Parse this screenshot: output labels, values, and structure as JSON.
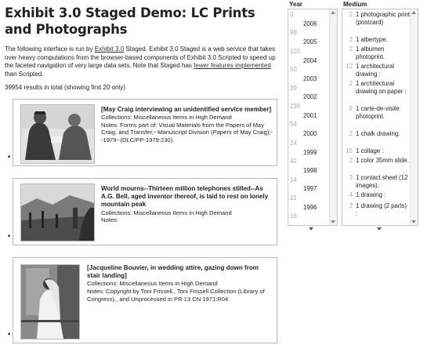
{
  "page": {
    "title": "Exhibit 3.0 Staged Demo: LC Prints and Photographs",
    "intro_text_1": "The following interface is run by ",
    "intro_link_1": "Exhibit 3.0",
    "intro_text_2": " Staged. Exhibit 3.0 Staged is a web service that takes over heavy computations from the browser-based components of Exhibit 3.0 Scripted to speed up the faceted navigation of very large data sets. Note that Staged has ",
    "intro_link_2": "fewer features implemented",
    "intro_text_3": " than Scripted.",
    "results_count": "39954 results in total (showing first 20 only)"
  },
  "results": [
    {
      "title": "[May Craig interviewing an unidentified service member]",
      "lines": [
        "Collections: Miscellaneous Items in High Demand",
        "Notes: Forms part of: Visual Materials from the Papers of May Craig. and Transfer;--Manuscript Division (Papers of May Craig);--1979--(DLC/PP-1979:230)."
      ]
    },
    {
      "title": "World mourns--Thirteen million telephones stilled--As A.G. Bell, aged inventor thereof, is laid to rest on lonely mountain peak",
      "lines": [
        "Collections: Miscellaneous Items in High Demand",
        "Notes:"
      ]
    },
    {
      "title": "[Jacqueline Bouvier, in wedding attire, gazing down from stair landing]",
      "lines": [
        "Collections: Miscellaneous Items in High Demand",
        "Notes: Copyright by Toni Frissell., Toni Frissell Collection (Library of Congress)., and Unprocessed in PR 13 CN 1971:R04"
      ]
    }
  ],
  "facets": {
    "year": {
      "label": "Year",
      "items": [
        {
          "count": "3",
          "value": ""
        },
        {
          "count": "",
          "value": "2006"
        },
        {
          "count": "98",
          "value": ""
        },
        {
          "count": "",
          "value": "2005"
        },
        {
          "count": "103",
          "value": ""
        },
        {
          "count": "",
          "value": "2004"
        },
        {
          "count": "50",
          "value": ""
        },
        {
          "count": "",
          "value": "2003"
        },
        {
          "count": "39",
          "value": ""
        },
        {
          "count": "",
          "value": "2002"
        },
        {
          "count": "239",
          "value": ""
        },
        {
          "count": "",
          "value": "2001"
        },
        {
          "count": "54",
          "value": ""
        },
        {
          "count": "",
          "value": "2000"
        },
        {
          "count": "24",
          "value": ""
        },
        {
          "count": "",
          "value": "1999"
        },
        {
          "count": "42",
          "value": ""
        },
        {
          "count": "",
          "value": "1998"
        },
        {
          "count": "14",
          "value": ""
        },
        {
          "count": "",
          "value": "1997"
        },
        {
          "count": "21",
          "value": ""
        },
        {
          "count": "",
          "value": "1996"
        },
        {
          "count": "16",
          "value": ""
        }
      ]
    },
    "medium": {
      "label": "Medium",
      "items": [
        {
          "count": "2",
          "value": "1 photographic print (postcard)"
        },
        {
          "count": "2",
          "value": "1 albertype."
        },
        {
          "count": "2",
          "value": "1 albumen photoprint."
        },
        {
          "count": "12",
          "value": "1 architectural drawing :"
        },
        {
          "count": "2",
          "value": "1 architectural drawing on paper :"
        },
        {
          "count": "8",
          "value": "1 carte-de-visite photoprint."
        },
        {
          "count": "2",
          "value": "1 chalk drawing."
        },
        {
          "count": "15",
          "value": "1 collage :"
        },
        {
          "count": "2",
          "value": "1 color 35mm slide."
        },
        {
          "count": "3",
          "value": "1 contact sheet (12 images)."
        },
        {
          "count": "4",
          "value": "1 drawing :"
        },
        {
          "count": "2",
          "value": "1 drawing (2 parts) :"
        }
      ]
    }
  }
}
